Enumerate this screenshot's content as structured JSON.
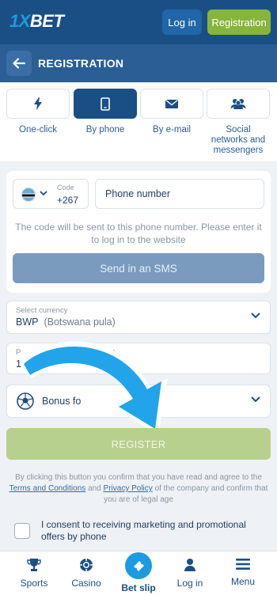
{
  "header": {
    "logo_prefix": "1X",
    "logo_suffix": "BET",
    "login_label": "Log in",
    "registration_label": "Registration"
  },
  "titlebar": {
    "title": "REGISTRATION"
  },
  "tabs": [
    {
      "label": "One-click",
      "icon": "lightning-icon",
      "active": false
    },
    {
      "label": "By phone",
      "icon": "smartphone-icon",
      "active": true
    },
    {
      "label": "By e-mail",
      "icon": "envelope-icon",
      "active": false
    },
    {
      "label": "Social networks and messengers",
      "icon": "people-icon",
      "active": false
    }
  ],
  "phone_form": {
    "code_label": "Code",
    "code_value": "+267",
    "phone_placeholder": "Phone number",
    "hint": "The code will be sent to this phone number. Please enter it to log in to the website",
    "send_sms_label": "Send in an SMS"
  },
  "currency": {
    "label": "Select currency",
    "code": "BWP",
    "name": "(Botswana pula)"
  },
  "promo": {
    "label_start": "P",
    "label_end": "ne)",
    "value": "1xDLD"
  },
  "bonus": {
    "label": "Bonus fo"
  },
  "register_label": "REGISTER",
  "terms": {
    "part1": "By clicking this button you confirm that you have read and agree to the",
    "link1": "Terms and Conditions",
    "part2": "and",
    "link2": "Privacy Policy",
    "part3": "of the company and confirm that you are of legal age"
  },
  "consent": {
    "text": "I consent to receiving marketing and promotional offers by phone"
  },
  "bottom_nav": [
    {
      "label": "Sports",
      "icon": "trophy-icon"
    },
    {
      "label": "Casino",
      "icon": "casino-chip-icon"
    },
    {
      "label": "Bet slip",
      "icon": "ticket-icon",
      "active": true
    },
    {
      "label": "Log in",
      "icon": "person-icon"
    },
    {
      "label": "Menu",
      "icon": "hamburger-icon"
    }
  ],
  "colors": {
    "primary": "#1a4f86",
    "accent_green": "#86b53b",
    "accent_blue": "#1b9be0"
  }
}
